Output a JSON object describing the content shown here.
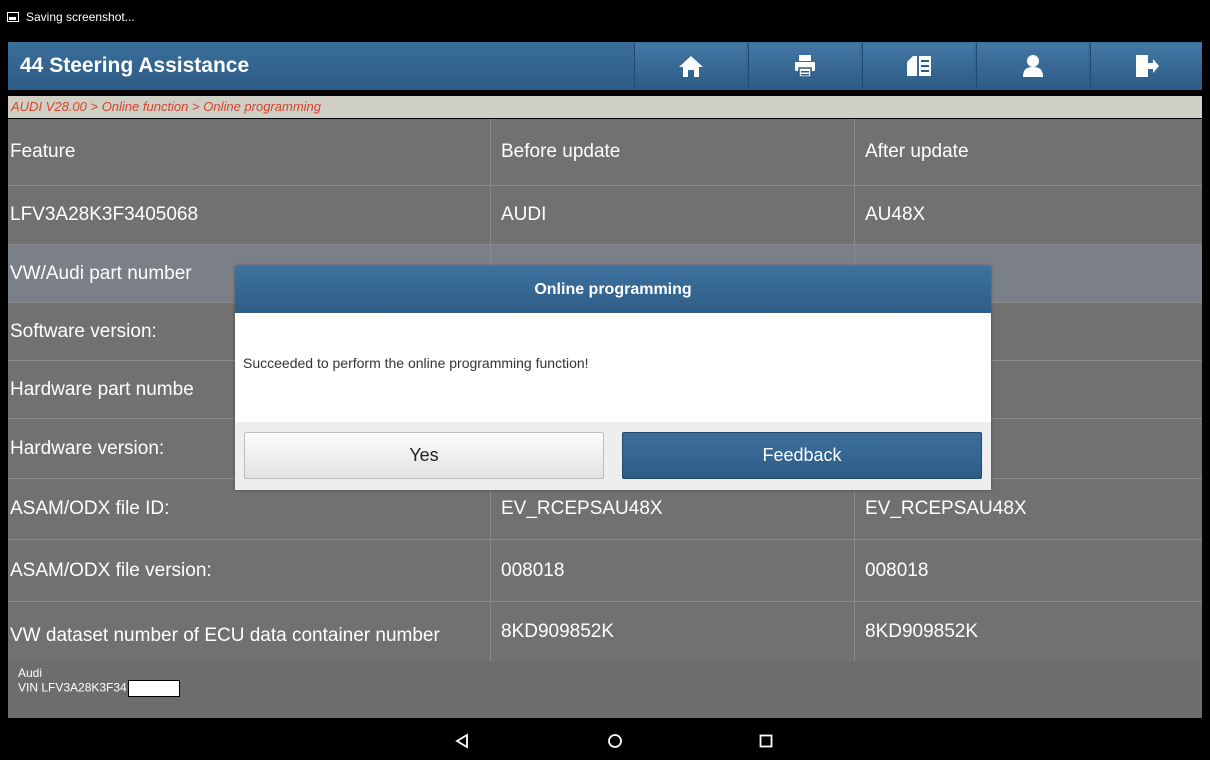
{
  "status_bar": {
    "text": "Saving screenshot..."
  },
  "header": {
    "title": "44 Steering Assistance",
    "tools": [
      "home-icon",
      "print-icon",
      "report-icon",
      "user-icon",
      "exit-icon"
    ]
  },
  "breadcrumb": "AUDI V28.00 > Online function > Online programming",
  "table": {
    "headers": [
      "Feature",
      "Before update",
      "After update"
    ],
    "rows": [
      [
        "LFV3A28K3F3405068",
        "AUDI",
        "AU48X"
      ],
      [
        "VW/Audi part number",
        "",
        ""
      ],
      [
        "Software version:",
        "",
        ""
      ],
      [
        "Hardware part numbe",
        "",
        ""
      ],
      [
        "Hardware version:",
        "",
        ""
      ],
      [
        "ASAM/ODX file ID:",
        "EV_RCEPSAU48X",
        "EV_RCEPSAU48X"
      ],
      [
        "ASAM/ODX file version:",
        "008018",
        "008018"
      ],
      [
        "VW dataset number of ECU data container number",
        "8KD909852K",
        "8KD909852K"
      ]
    ]
  },
  "footer": {
    "make": "Audi",
    "vin": "VIN LFV3A28K3F34"
  },
  "dialog": {
    "title": "Online programming",
    "message": "Succeeded to perform the online programming function!",
    "yes_label": "Yes",
    "feedback_label": "Feedback"
  },
  "navigation": [
    "back-icon",
    "home-circle-icon",
    "recents-icon"
  ]
}
